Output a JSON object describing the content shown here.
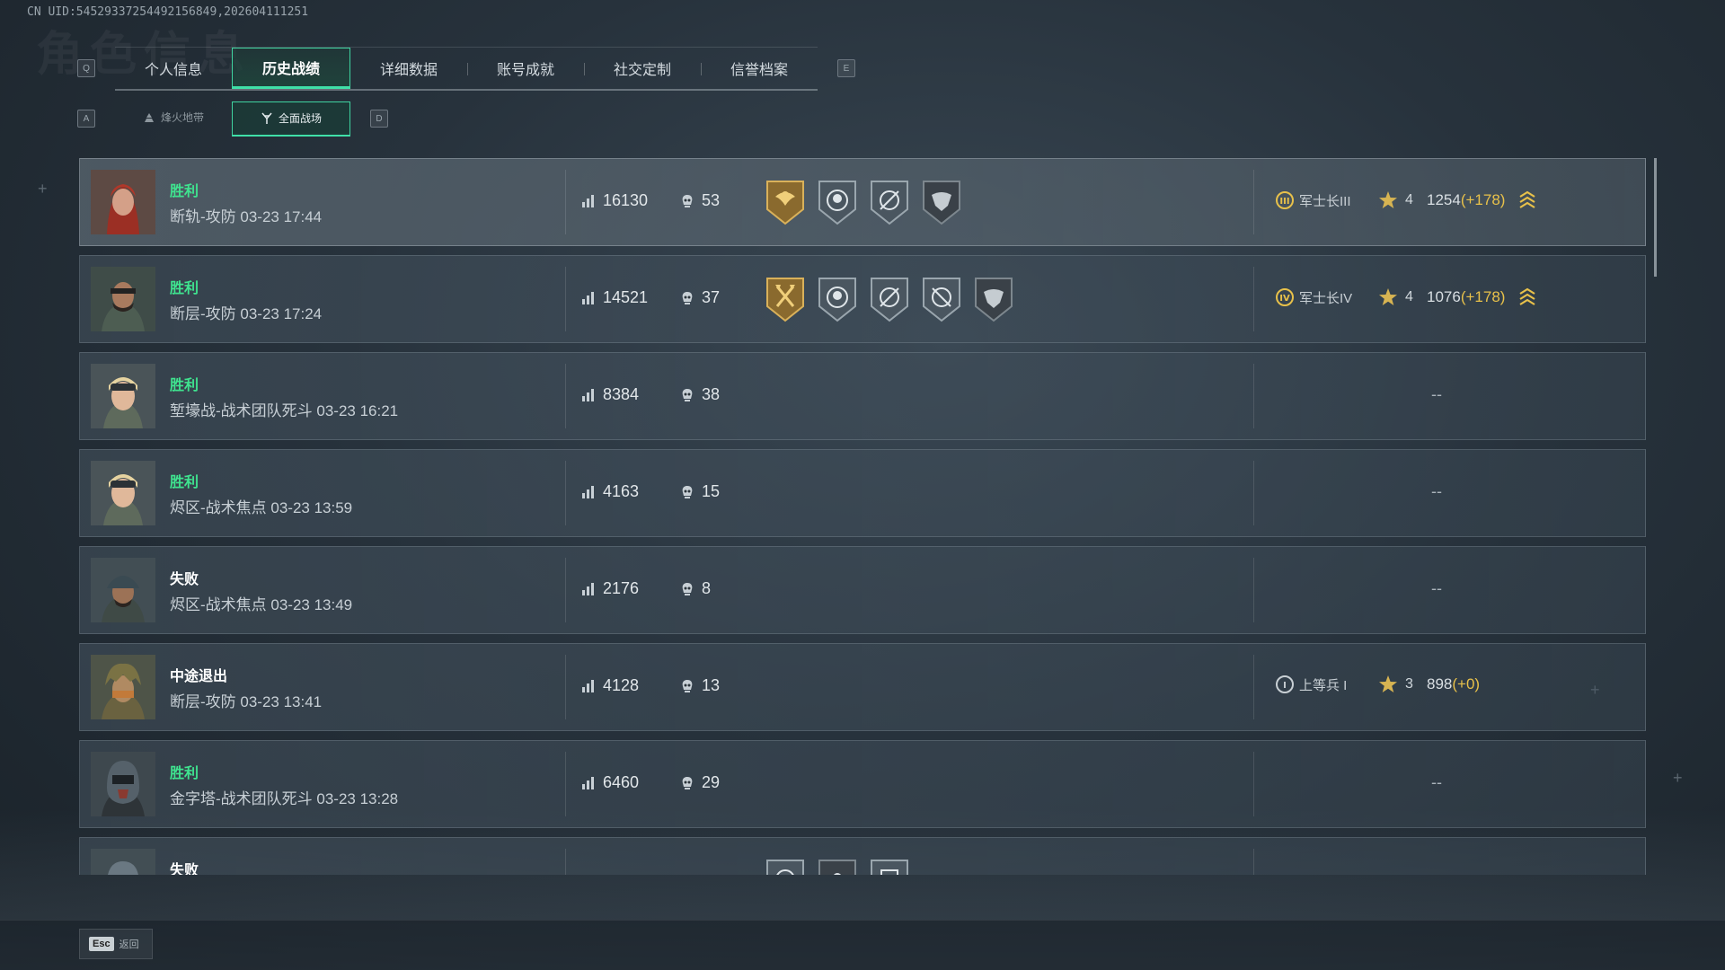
{
  "uid": "CN UID:545293372544921568​49,202604111251",
  "watermark": "角色信息",
  "tabs": {
    "left_key": "Q",
    "right_key": "E",
    "items": [
      "个人信息",
      "历史战绩",
      "详细数据",
      "账号成就",
      "社交定制",
      "信誉档案"
    ],
    "active_index": 1
  },
  "subtabs": {
    "left_key": "A",
    "right_key": "D",
    "items": [
      "烽火地带",
      "全面战场"
    ],
    "active_index": 1
  },
  "matches": [
    {
      "result": "胜利",
      "outcome": "win",
      "map": "断轨-攻防 03-23 17:44",
      "score": "16130",
      "kills": "53",
      "badges": [
        "gold-eagle",
        "skull",
        "crosshair",
        "eagle-dark"
      ],
      "rank": {
        "icon": "III",
        "name": "军士长III",
        "stars": "4",
        "points": "1254",
        "delta": "(+178)",
        "chevrons": true
      }
    },
    {
      "result": "胜利",
      "outcome": "win",
      "map": "断层-攻防 03-23 17:24",
      "score": "14521",
      "kills": "37",
      "badges": [
        "gold-axes",
        "skull",
        "crosshair",
        "crosshair",
        "eagle-dark"
      ],
      "rank": {
        "icon": "IV",
        "name": "军士长IV",
        "stars": "4",
        "points": "1076",
        "delta": "(+178)",
        "chevrons": true
      }
    },
    {
      "result": "胜利",
      "outcome": "win",
      "map": "堑壕战-战术团队死斗 03-23 16:21",
      "score": "8384",
      "kills": "38",
      "badges": [],
      "rank": null,
      "dash": "--"
    },
    {
      "result": "胜利",
      "outcome": "win",
      "map": "烬区-战术焦点 03-23 13:59",
      "score": "4163",
      "kills": "15",
      "badges": [],
      "rank": null,
      "dash": "--"
    },
    {
      "result": "失败",
      "outcome": "lose",
      "map": "烬区-战术焦点 03-23 13:49",
      "score": "2176",
      "kills": "8",
      "badges": [],
      "rank": null,
      "dash": "--"
    },
    {
      "result": "中途退出",
      "outcome": "lose",
      "map": "断层-攻防 03-23 13:41",
      "score": "4128",
      "kills": "13",
      "badges": [],
      "rank": {
        "icon": "I",
        "name": "上等兵 I",
        "stars": "3",
        "points": "898",
        "delta": "(+0)",
        "chevrons": false
      }
    },
    {
      "result": "胜利",
      "outcome": "win",
      "map": "金字塔-战术团队死斗 03-23 13:28",
      "score": "6460",
      "kills": "29",
      "badges": [],
      "rank": null,
      "dash": "--"
    },
    {
      "result": "失败",
      "outcome": "lose",
      "map": "",
      "score": "",
      "kills": "",
      "badges": [
        "crosshair",
        "skull",
        "crosshair"
      ],
      "rank": null
    }
  ],
  "footer": {
    "esc_key": "Esc",
    "back_label": "返回"
  },
  "colors": {
    "accent": "#3fe0a8",
    "win": "#3fe38f",
    "gold": "#e8c14a"
  }
}
